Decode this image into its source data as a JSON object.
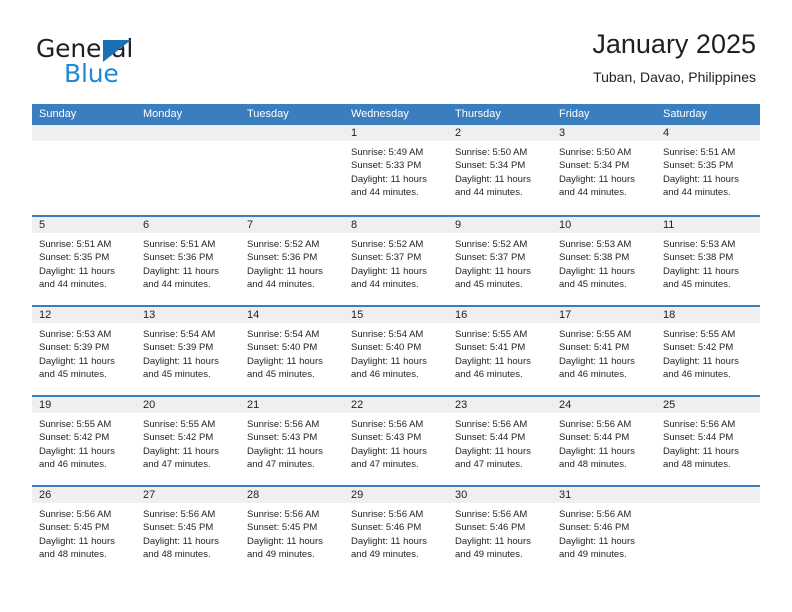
{
  "brand": {
    "name_part1": "General",
    "name_part2": "Blue",
    "accent_color": "#1e8ad6",
    "triangle_color": "#1a6fb5"
  },
  "header": {
    "title": "January 2025",
    "subtitle": "Tuban, Davao, Philippines"
  },
  "theme": {
    "header_row_bg": "#3a7ebf",
    "day_band_bg": "#efefef",
    "row_divider": "#3a7ebf",
    "text": "#231f20"
  },
  "weekdays": [
    "Sunday",
    "Monday",
    "Tuesday",
    "Wednesday",
    "Thursday",
    "Friday",
    "Saturday"
  ],
  "weeks": [
    [
      {
        "day": ""
      },
      {
        "day": ""
      },
      {
        "day": ""
      },
      {
        "day": "1",
        "sunrise": "Sunrise: 5:49 AM",
        "sunset": "Sunset: 5:33 PM",
        "daylight1": "Daylight: 11 hours",
        "daylight2": "and 44 minutes."
      },
      {
        "day": "2",
        "sunrise": "Sunrise: 5:50 AM",
        "sunset": "Sunset: 5:34 PM",
        "daylight1": "Daylight: 11 hours",
        "daylight2": "and 44 minutes."
      },
      {
        "day": "3",
        "sunrise": "Sunrise: 5:50 AM",
        "sunset": "Sunset: 5:34 PM",
        "daylight1": "Daylight: 11 hours",
        "daylight2": "and 44 minutes."
      },
      {
        "day": "4",
        "sunrise": "Sunrise: 5:51 AM",
        "sunset": "Sunset: 5:35 PM",
        "daylight1": "Daylight: 11 hours",
        "daylight2": "and 44 minutes."
      }
    ],
    [
      {
        "day": "5",
        "sunrise": "Sunrise: 5:51 AM",
        "sunset": "Sunset: 5:35 PM",
        "daylight1": "Daylight: 11 hours",
        "daylight2": "and 44 minutes."
      },
      {
        "day": "6",
        "sunrise": "Sunrise: 5:51 AM",
        "sunset": "Sunset: 5:36 PM",
        "daylight1": "Daylight: 11 hours",
        "daylight2": "and 44 minutes."
      },
      {
        "day": "7",
        "sunrise": "Sunrise: 5:52 AM",
        "sunset": "Sunset: 5:36 PM",
        "daylight1": "Daylight: 11 hours",
        "daylight2": "and 44 minutes."
      },
      {
        "day": "8",
        "sunrise": "Sunrise: 5:52 AM",
        "sunset": "Sunset: 5:37 PM",
        "daylight1": "Daylight: 11 hours",
        "daylight2": "and 44 minutes."
      },
      {
        "day": "9",
        "sunrise": "Sunrise: 5:52 AM",
        "sunset": "Sunset: 5:37 PM",
        "daylight1": "Daylight: 11 hours",
        "daylight2": "and 45 minutes."
      },
      {
        "day": "10",
        "sunrise": "Sunrise: 5:53 AM",
        "sunset": "Sunset: 5:38 PM",
        "daylight1": "Daylight: 11 hours",
        "daylight2": "and 45 minutes."
      },
      {
        "day": "11",
        "sunrise": "Sunrise: 5:53 AM",
        "sunset": "Sunset: 5:38 PM",
        "daylight1": "Daylight: 11 hours",
        "daylight2": "and 45 minutes."
      }
    ],
    [
      {
        "day": "12",
        "sunrise": "Sunrise: 5:53 AM",
        "sunset": "Sunset: 5:39 PM",
        "daylight1": "Daylight: 11 hours",
        "daylight2": "and 45 minutes."
      },
      {
        "day": "13",
        "sunrise": "Sunrise: 5:54 AM",
        "sunset": "Sunset: 5:39 PM",
        "daylight1": "Daylight: 11 hours",
        "daylight2": "and 45 minutes."
      },
      {
        "day": "14",
        "sunrise": "Sunrise: 5:54 AM",
        "sunset": "Sunset: 5:40 PM",
        "daylight1": "Daylight: 11 hours",
        "daylight2": "and 45 minutes."
      },
      {
        "day": "15",
        "sunrise": "Sunrise: 5:54 AM",
        "sunset": "Sunset: 5:40 PM",
        "daylight1": "Daylight: 11 hours",
        "daylight2": "and 46 minutes."
      },
      {
        "day": "16",
        "sunrise": "Sunrise: 5:55 AM",
        "sunset": "Sunset: 5:41 PM",
        "daylight1": "Daylight: 11 hours",
        "daylight2": "and 46 minutes."
      },
      {
        "day": "17",
        "sunrise": "Sunrise: 5:55 AM",
        "sunset": "Sunset: 5:41 PM",
        "daylight1": "Daylight: 11 hours",
        "daylight2": "and 46 minutes."
      },
      {
        "day": "18",
        "sunrise": "Sunrise: 5:55 AM",
        "sunset": "Sunset: 5:42 PM",
        "daylight1": "Daylight: 11 hours",
        "daylight2": "and 46 minutes."
      }
    ],
    [
      {
        "day": "19",
        "sunrise": "Sunrise: 5:55 AM",
        "sunset": "Sunset: 5:42 PM",
        "daylight1": "Daylight: 11 hours",
        "daylight2": "and 46 minutes."
      },
      {
        "day": "20",
        "sunrise": "Sunrise: 5:55 AM",
        "sunset": "Sunset: 5:42 PM",
        "daylight1": "Daylight: 11 hours",
        "daylight2": "and 47 minutes."
      },
      {
        "day": "21",
        "sunrise": "Sunrise: 5:56 AM",
        "sunset": "Sunset: 5:43 PM",
        "daylight1": "Daylight: 11 hours",
        "daylight2": "and 47 minutes."
      },
      {
        "day": "22",
        "sunrise": "Sunrise: 5:56 AM",
        "sunset": "Sunset: 5:43 PM",
        "daylight1": "Daylight: 11 hours",
        "daylight2": "and 47 minutes."
      },
      {
        "day": "23",
        "sunrise": "Sunrise: 5:56 AM",
        "sunset": "Sunset: 5:44 PM",
        "daylight1": "Daylight: 11 hours",
        "daylight2": "and 47 minutes."
      },
      {
        "day": "24",
        "sunrise": "Sunrise: 5:56 AM",
        "sunset": "Sunset: 5:44 PM",
        "daylight1": "Daylight: 11 hours",
        "daylight2": "and 48 minutes."
      },
      {
        "day": "25",
        "sunrise": "Sunrise: 5:56 AM",
        "sunset": "Sunset: 5:44 PM",
        "daylight1": "Daylight: 11 hours",
        "daylight2": "and 48 minutes."
      }
    ],
    [
      {
        "day": "26",
        "sunrise": "Sunrise: 5:56 AM",
        "sunset": "Sunset: 5:45 PM",
        "daylight1": "Daylight: 11 hours",
        "daylight2": "and 48 minutes."
      },
      {
        "day": "27",
        "sunrise": "Sunrise: 5:56 AM",
        "sunset": "Sunset: 5:45 PM",
        "daylight1": "Daylight: 11 hours",
        "daylight2": "and 48 minutes."
      },
      {
        "day": "28",
        "sunrise": "Sunrise: 5:56 AM",
        "sunset": "Sunset: 5:45 PM",
        "daylight1": "Daylight: 11 hours",
        "daylight2": "and 49 minutes."
      },
      {
        "day": "29",
        "sunrise": "Sunrise: 5:56 AM",
        "sunset": "Sunset: 5:46 PM",
        "daylight1": "Daylight: 11 hours",
        "daylight2": "and 49 minutes."
      },
      {
        "day": "30",
        "sunrise": "Sunrise: 5:56 AM",
        "sunset": "Sunset: 5:46 PM",
        "daylight1": "Daylight: 11 hours",
        "daylight2": "and 49 minutes."
      },
      {
        "day": "31",
        "sunrise": "Sunrise: 5:56 AM",
        "sunset": "Sunset: 5:46 PM",
        "daylight1": "Daylight: 11 hours",
        "daylight2": "and 49 minutes."
      },
      {
        "day": ""
      }
    ]
  ]
}
